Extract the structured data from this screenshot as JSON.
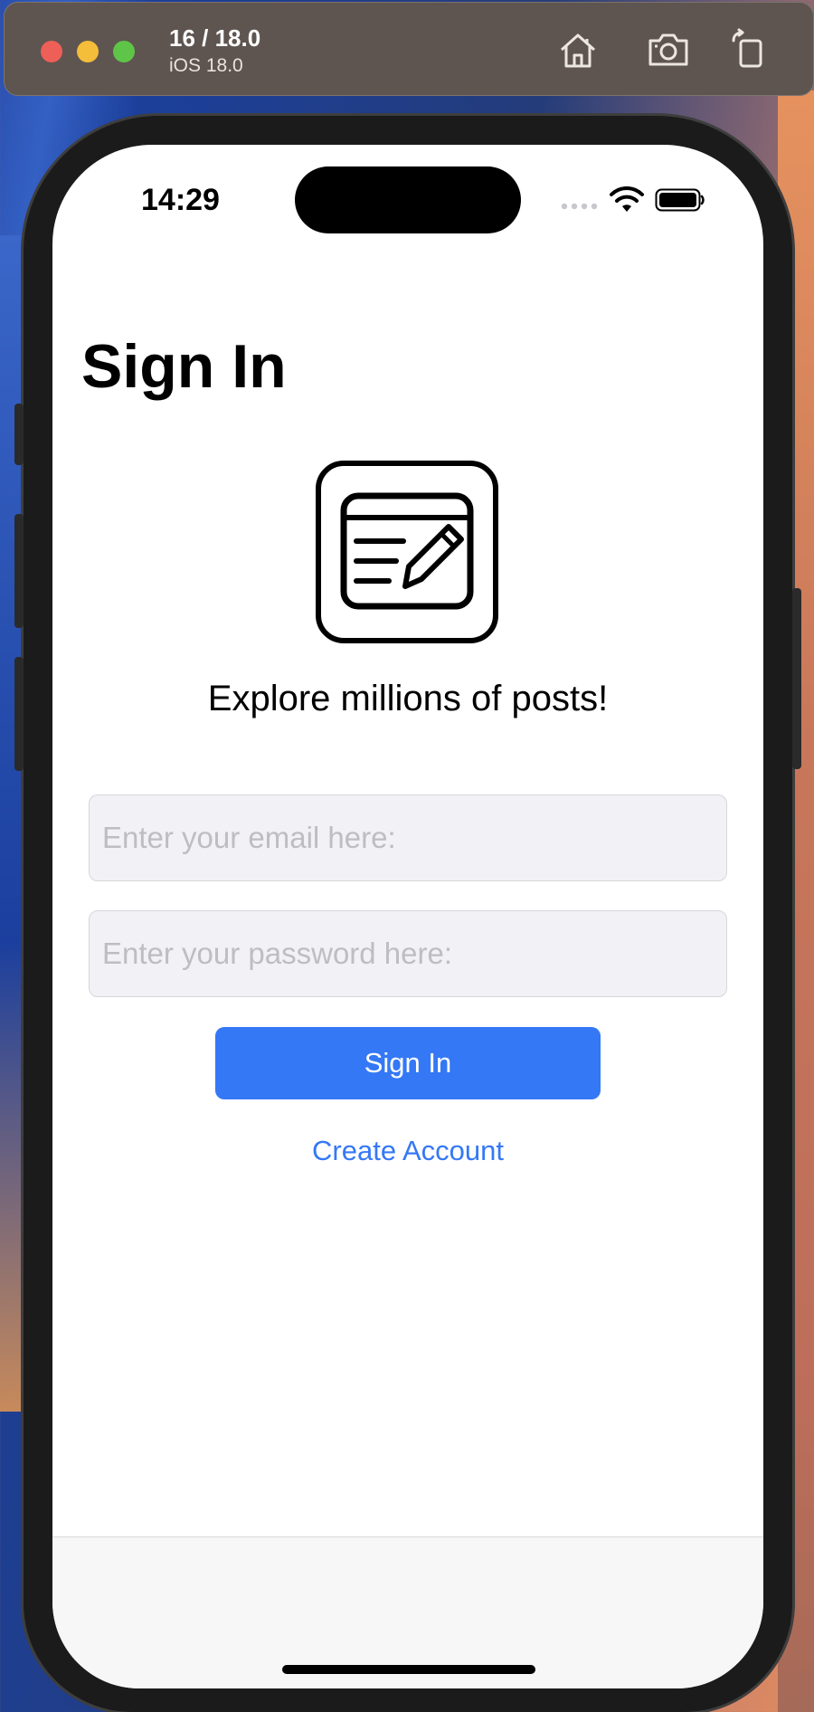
{
  "simulator": {
    "title": "16 / 18.0",
    "subtitle": "iOS 18.0",
    "icons": [
      "home-icon",
      "screenshot-icon",
      "rotate-icon"
    ]
  },
  "status_bar": {
    "time": "14:29",
    "icons": [
      "signal-dots-icon",
      "wifi-icon",
      "battery-icon"
    ]
  },
  "screen": {
    "title": "Sign In",
    "logo_icon": "news-edit-icon",
    "tagline": "Explore millions of posts!",
    "email_placeholder": "Enter your email here:",
    "password_placeholder": "Enter your password here:",
    "signin_label": "Sign In",
    "create_account_label": "Create Account"
  },
  "colors": {
    "accent": "#3478f6",
    "field_background": "#f1f1f6",
    "placeholder": "#bdbdc3"
  }
}
